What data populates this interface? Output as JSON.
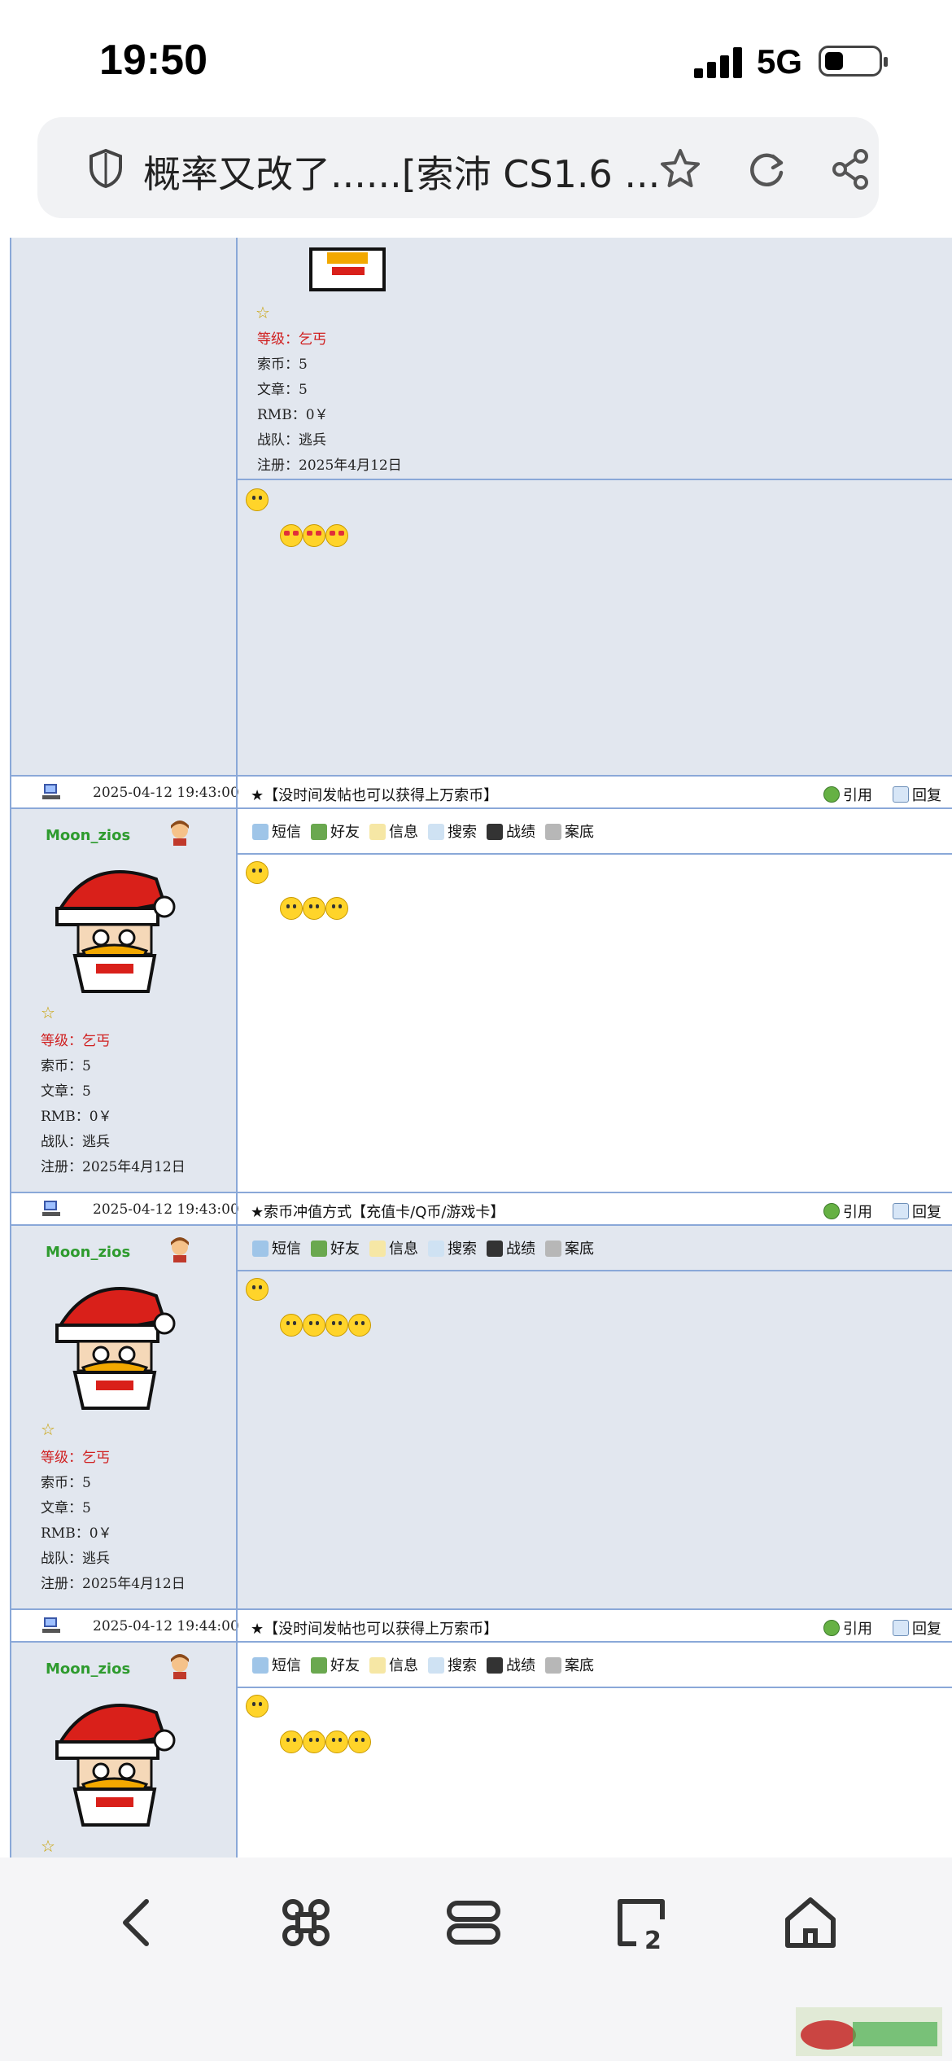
{
  "status_bar": {
    "time": "19:50",
    "network": "5G",
    "battery_level": 0.35
  },
  "url_bar": {
    "title": "概率又改了......[索沛 CS1.6 ..."
  },
  "posts": [
    {
      "partial": true,
      "user": {
        "star": "☆",
        "level_label": "等级：乞丐",
        "coins": "索币：5",
        "articles": "文章：5",
        "rmb": "RMB：0￥",
        "team": "战队：逃兵",
        "registered": "注册：2025年4月12日"
      },
      "emoji_count": 3,
      "emoji_kind": "love"
    },
    {
      "date": "2025-04-12 19:43:00",
      "announcement": "★【没时间发帖也可以获得上万索币】",
      "quote": "引用",
      "reply": "回复",
      "user": {
        "name": "Moon_zios",
        "star": "☆",
        "level_label": "等级：乞丐",
        "coins": "索币：5",
        "articles": "文章：5",
        "rmb": "RMB：0￥",
        "team": "战队：逃兵",
        "registered": "注册：2025年4月12日"
      },
      "toolbar": [
        "短信",
        "好友",
        "信息",
        "搜索",
        "战绩",
        "案底"
      ],
      "emoji_count": 3,
      "emoji_kind": "worried"
    },
    {
      "date": "2025-04-12 19:43:00",
      "announcement": "★索币冲值方式【充值卡/Q币/游戏卡】",
      "quote": "引用",
      "reply": "回复",
      "user": {
        "name": "Moon_zios",
        "star": "☆",
        "level_label": "等级：乞丐",
        "coins": "索币：5",
        "articles": "文章：5",
        "rmb": "RMB：0￥",
        "team": "战队：逃兵",
        "registered": "注册：2025年4月12日"
      },
      "toolbar": [
        "短信",
        "好友",
        "信息",
        "搜索",
        "战绩",
        "案底"
      ],
      "emoji_count": 4,
      "emoji_kind": "smile"
    },
    {
      "date": "2025-04-12 19:44:00",
      "announcement": "★【没时间发帖也可以获得上万索币】",
      "quote": "引用",
      "reply": "回复",
      "user": {
        "name": "Moon_zios",
        "star": "☆"
      },
      "toolbar": [
        "短信",
        "好友",
        "信息",
        "搜索",
        "战绩",
        "案底"
      ],
      "emoji_count": 4,
      "emoji_kind": "smile"
    }
  ],
  "bottom_nav": [
    "back-icon",
    "command-icon",
    "tabs-icon",
    "tab-count-icon",
    "home-icon"
  ],
  "colors": {
    "border": "#8aa8d8",
    "gray_bg": "#e2e7ef",
    "username": "#2e9b2e",
    "level": "#d02020"
  }
}
